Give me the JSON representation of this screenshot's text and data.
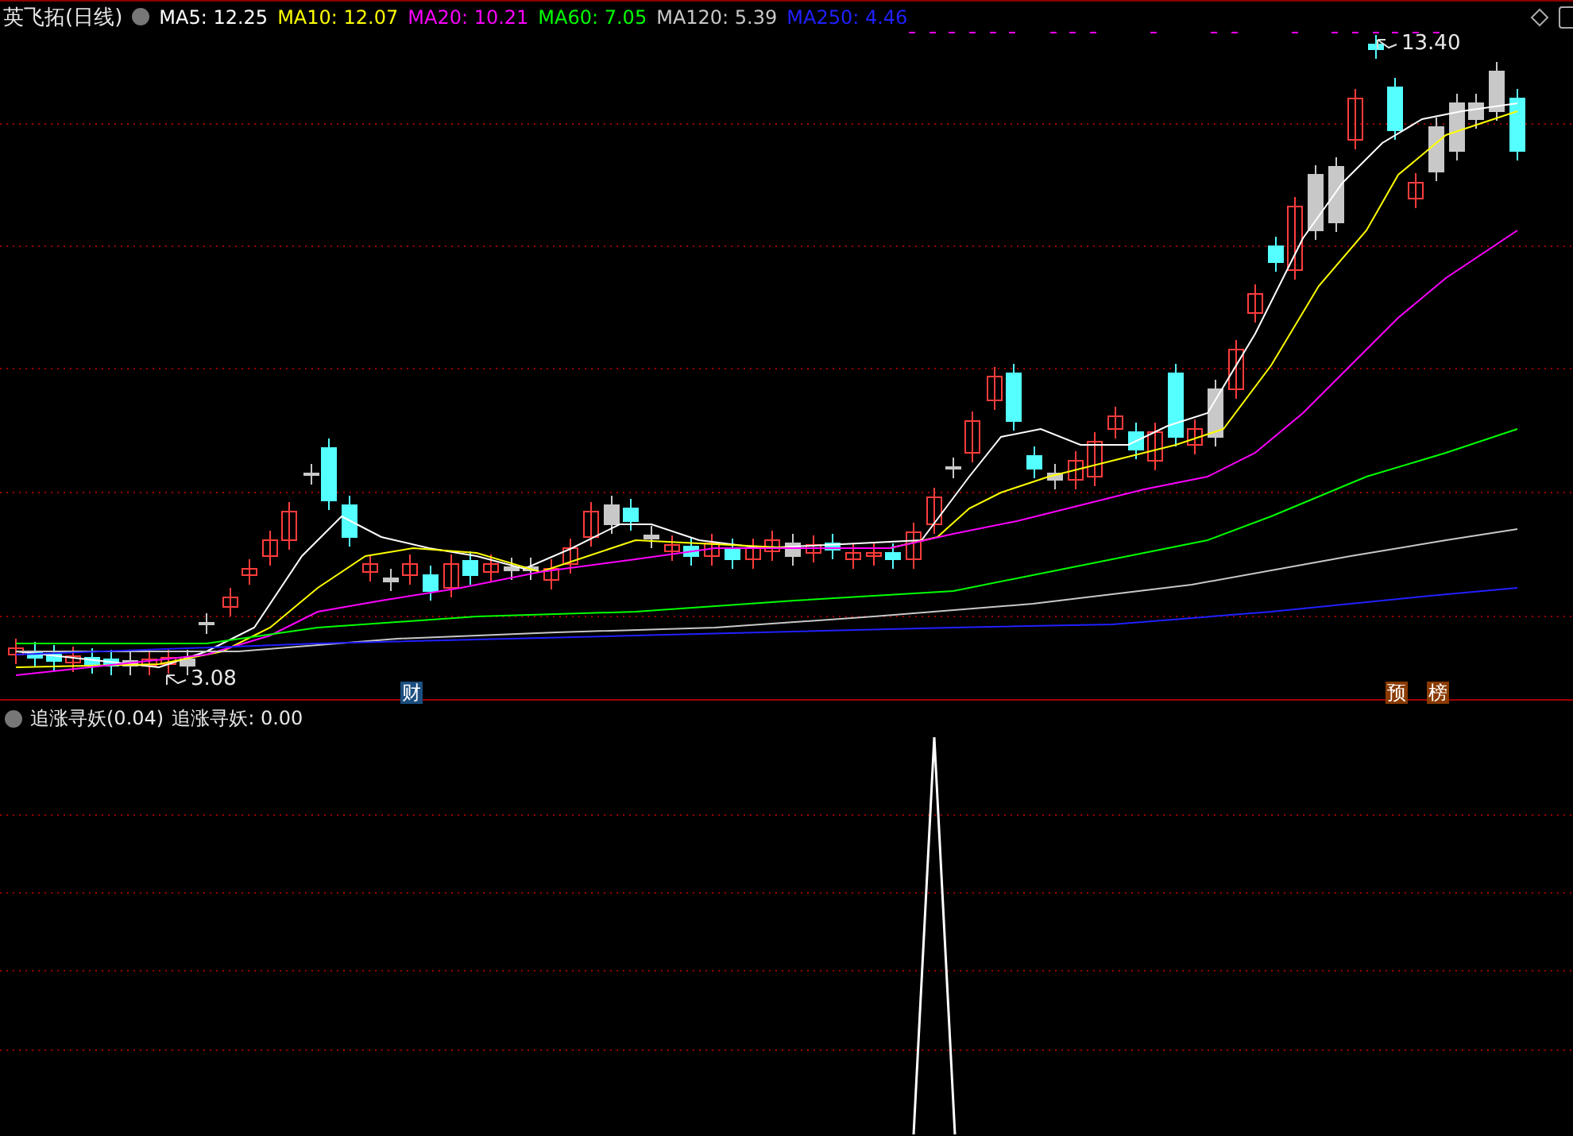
{
  "title": {
    "name": "英飞拓(日线)"
  },
  "ma_legend": [
    {
      "label": "MA5: 12.25",
      "color": "#ffffff"
    },
    {
      "label": "MA10: 12.07",
      "color": "#ffff00"
    },
    {
      "label": "MA20: 10.21",
      "color": "#ff00ff"
    },
    {
      "label": "MA60: 7.05",
      "color": "#00ff00"
    },
    {
      "label": "MA120: 5.39",
      "color": "#c8c8c8"
    },
    {
      "label": "MA250: 4.46",
      "color": "#2020ff"
    }
  ],
  "price_marks": [
    {
      "kind": "high",
      "text": "13.40"
    },
    {
      "kind": "low",
      "text": "3.08"
    }
  ],
  "event_badges": [
    {
      "text": "财",
      "color": "#1c4e80"
    },
    {
      "text": "预",
      "color": "#8a3a00"
    },
    {
      "text": "榜",
      "color": "#8a3a00"
    }
  ],
  "indicator": {
    "title": "追涨寻妖(0.04)",
    "value": "追涨寻妖: 0.00"
  }
}
